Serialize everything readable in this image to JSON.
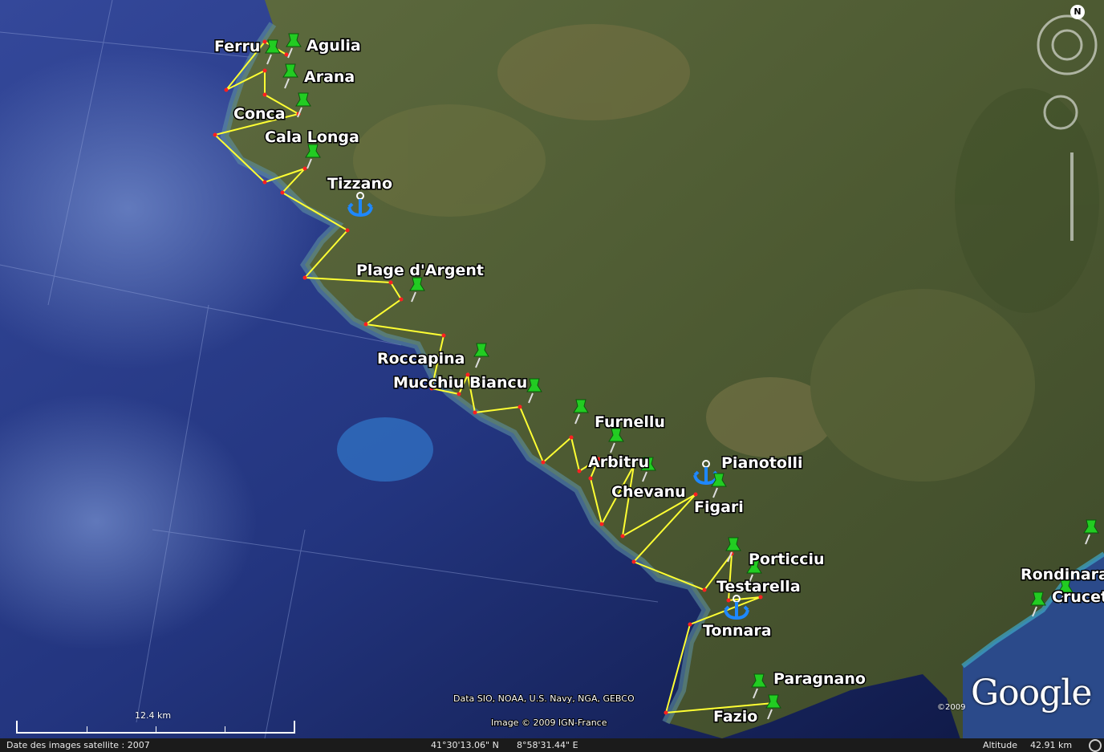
{
  "places": {
    "ferru": "Ferru",
    "agulia": "Agulia",
    "arana": "Arana",
    "conca": "Conca",
    "cala_longa": "Cala Longa",
    "tizzano": "Tizzano",
    "plage_argent": "Plage d'Argent",
    "roccapina": "Roccapina",
    "mucchiu_biancu": "Mucchiu Biancu",
    "furnellu": "Furnellu",
    "arbitru": "Arbitru",
    "chevanu": "Chevanu",
    "pianotolli": "Pianotolli",
    "figari": "Figari",
    "porticciu": "Porticciu",
    "testarella": "Testarella",
    "tonnara": "Tonnara",
    "paragnano": "Paragnano",
    "fazio": "Fazio",
    "rondinara": "Rondinara",
    "crucetta": "Crucet"
  },
  "credits": {
    "data": "Data SIO, NOAA, U.S. Navy, NGA, GEBCO",
    "image": "Image © 2009 IGN-France"
  },
  "logo": {
    "text": "Google",
    "copyright": "©2009"
  },
  "scale": {
    "label": "12.4 km"
  },
  "status": {
    "imagery_date": "Date des images satellite : 2007",
    "latitude": "41°30'13.06\" N",
    "longitude": "8°58'31.44\" E",
    "altitude_label": "Altitude",
    "altitude_value": "42.91 km"
  },
  "nav": {
    "north": "N"
  },
  "colors": {
    "route": "#ffff33",
    "waypoint": "#ff2020",
    "pin": "#22cc22",
    "anchor": "#2288ff",
    "sea_deep": "#1d2f7a",
    "land": "#4a5a30"
  }
}
